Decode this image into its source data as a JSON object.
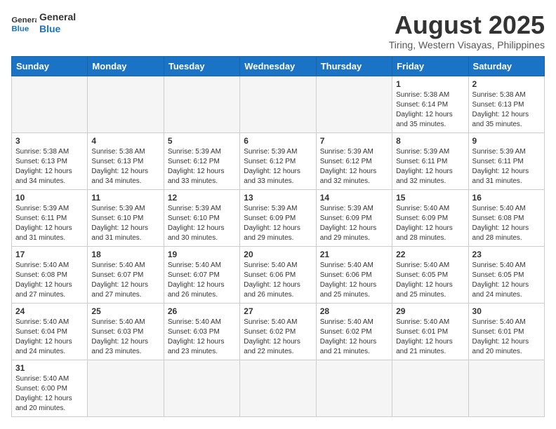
{
  "header": {
    "logo_general": "General",
    "logo_blue": "Blue",
    "month_year": "August 2025",
    "location": "Tiring, Western Visayas, Philippines"
  },
  "weekdays": [
    "Sunday",
    "Monday",
    "Tuesday",
    "Wednesday",
    "Thursday",
    "Friday",
    "Saturday"
  ],
  "weeks": [
    [
      {
        "day": "",
        "info": ""
      },
      {
        "day": "",
        "info": ""
      },
      {
        "day": "",
        "info": ""
      },
      {
        "day": "",
        "info": ""
      },
      {
        "day": "",
        "info": ""
      },
      {
        "day": "1",
        "info": "Sunrise: 5:38 AM\nSunset: 6:14 PM\nDaylight: 12 hours\nand 35 minutes."
      },
      {
        "day": "2",
        "info": "Sunrise: 5:38 AM\nSunset: 6:13 PM\nDaylight: 12 hours\nand 35 minutes."
      }
    ],
    [
      {
        "day": "3",
        "info": "Sunrise: 5:38 AM\nSunset: 6:13 PM\nDaylight: 12 hours\nand 34 minutes."
      },
      {
        "day": "4",
        "info": "Sunrise: 5:38 AM\nSunset: 6:13 PM\nDaylight: 12 hours\nand 34 minutes."
      },
      {
        "day": "5",
        "info": "Sunrise: 5:39 AM\nSunset: 6:12 PM\nDaylight: 12 hours\nand 33 minutes."
      },
      {
        "day": "6",
        "info": "Sunrise: 5:39 AM\nSunset: 6:12 PM\nDaylight: 12 hours\nand 33 minutes."
      },
      {
        "day": "7",
        "info": "Sunrise: 5:39 AM\nSunset: 6:12 PM\nDaylight: 12 hours\nand 32 minutes."
      },
      {
        "day": "8",
        "info": "Sunrise: 5:39 AM\nSunset: 6:11 PM\nDaylight: 12 hours\nand 32 minutes."
      },
      {
        "day": "9",
        "info": "Sunrise: 5:39 AM\nSunset: 6:11 PM\nDaylight: 12 hours\nand 31 minutes."
      }
    ],
    [
      {
        "day": "10",
        "info": "Sunrise: 5:39 AM\nSunset: 6:11 PM\nDaylight: 12 hours\nand 31 minutes."
      },
      {
        "day": "11",
        "info": "Sunrise: 5:39 AM\nSunset: 6:10 PM\nDaylight: 12 hours\nand 31 minutes."
      },
      {
        "day": "12",
        "info": "Sunrise: 5:39 AM\nSunset: 6:10 PM\nDaylight: 12 hours\nand 30 minutes."
      },
      {
        "day": "13",
        "info": "Sunrise: 5:39 AM\nSunset: 6:09 PM\nDaylight: 12 hours\nand 29 minutes."
      },
      {
        "day": "14",
        "info": "Sunrise: 5:39 AM\nSunset: 6:09 PM\nDaylight: 12 hours\nand 29 minutes."
      },
      {
        "day": "15",
        "info": "Sunrise: 5:40 AM\nSunset: 6:09 PM\nDaylight: 12 hours\nand 28 minutes."
      },
      {
        "day": "16",
        "info": "Sunrise: 5:40 AM\nSunset: 6:08 PM\nDaylight: 12 hours\nand 28 minutes."
      }
    ],
    [
      {
        "day": "17",
        "info": "Sunrise: 5:40 AM\nSunset: 6:08 PM\nDaylight: 12 hours\nand 27 minutes."
      },
      {
        "day": "18",
        "info": "Sunrise: 5:40 AM\nSunset: 6:07 PM\nDaylight: 12 hours\nand 27 minutes."
      },
      {
        "day": "19",
        "info": "Sunrise: 5:40 AM\nSunset: 6:07 PM\nDaylight: 12 hours\nand 26 minutes."
      },
      {
        "day": "20",
        "info": "Sunrise: 5:40 AM\nSunset: 6:06 PM\nDaylight: 12 hours\nand 26 minutes."
      },
      {
        "day": "21",
        "info": "Sunrise: 5:40 AM\nSunset: 6:06 PM\nDaylight: 12 hours\nand 25 minutes."
      },
      {
        "day": "22",
        "info": "Sunrise: 5:40 AM\nSunset: 6:05 PM\nDaylight: 12 hours\nand 25 minutes."
      },
      {
        "day": "23",
        "info": "Sunrise: 5:40 AM\nSunset: 6:05 PM\nDaylight: 12 hours\nand 24 minutes."
      }
    ],
    [
      {
        "day": "24",
        "info": "Sunrise: 5:40 AM\nSunset: 6:04 PM\nDaylight: 12 hours\nand 24 minutes."
      },
      {
        "day": "25",
        "info": "Sunrise: 5:40 AM\nSunset: 6:03 PM\nDaylight: 12 hours\nand 23 minutes."
      },
      {
        "day": "26",
        "info": "Sunrise: 5:40 AM\nSunset: 6:03 PM\nDaylight: 12 hours\nand 23 minutes."
      },
      {
        "day": "27",
        "info": "Sunrise: 5:40 AM\nSunset: 6:02 PM\nDaylight: 12 hours\nand 22 minutes."
      },
      {
        "day": "28",
        "info": "Sunrise: 5:40 AM\nSunset: 6:02 PM\nDaylight: 12 hours\nand 21 minutes."
      },
      {
        "day": "29",
        "info": "Sunrise: 5:40 AM\nSunset: 6:01 PM\nDaylight: 12 hours\nand 21 minutes."
      },
      {
        "day": "30",
        "info": "Sunrise: 5:40 AM\nSunset: 6:01 PM\nDaylight: 12 hours\nand 20 minutes."
      }
    ],
    [
      {
        "day": "31",
        "info": "Sunrise: 5:40 AM\nSunset: 6:00 PM\nDaylight: 12 hours\nand 20 minutes."
      },
      {
        "day": "",
        "info": ""
      },
      {
        "day": "",
        "info": ""
      },
      {
        "day": "",
        "info": ""
      },
      {
        "day": "",
        "info": ""
      },
      {
        "day": "",
        "info": ""
      },
      {
        "day": "",
        "info": ""
      }
    ]
  ]
}
